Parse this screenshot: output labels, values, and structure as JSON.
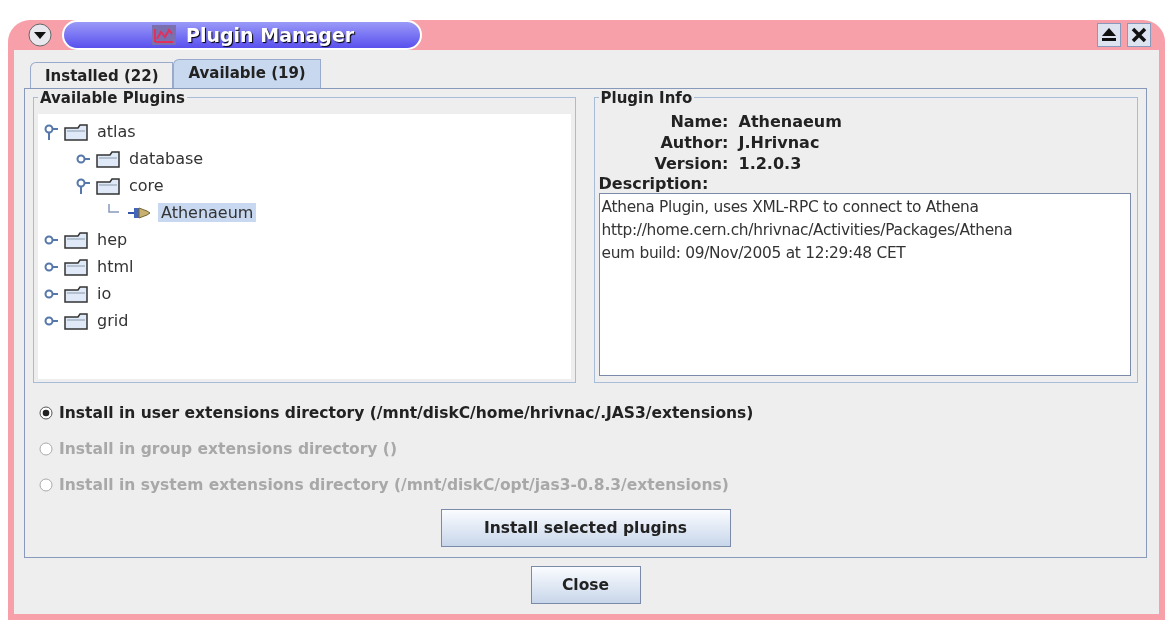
{
  "window": {
    "title": "Plugin Manager"
  },
  "tabs": [
    {
      "label": "Installed (22)",
      "selected": false
    },
    {
      "label": "Available (19)",
      "selected": true
    }
  ],
  "tree_panel": {
    "title": "Available Plugins",
    "items": [
      {
        "label": "atlas",
        "kind": "folder",
        "expanded": true,
        "selected": false,
        "children": [
          {
            "label": "database",
            "kind": "folder",
            "expanded": false,
            "selected": false
          },
          {
            "label": "core",
            "kind": "folder",
            "expanded": true,
            "selected": false,
            "children": [
              {
                "label": "Athenaeum",
                "kind": "plugin",
                "selected": true
              }
            ]
          }
        ]
      },
      {
        "label": "hep",
        "kind": "folder",
        "expanded": false,
        "selected": false
      },
      {
        "label": "html",
        "kind": "folder",
        "expanded": false,
        "selected": false
      },
      {
        "label": "io",
        "kind": "folder",
        "expanded": false,
        "selected": false
      },
      {
        "label": "grid",
        "kind": "folder",
        "expanded": false,
        "selected": false
      }
    ]
  },
  "info_panel": {
    "title": "Plugin Info",
    "fields": [
      {
        "label": "Name:",
        "value": "Athenaeum"
      },
      {
        "label": "Author:",
        "value": "J.Hrivnac"
      },
      {
        "label": "Version:",
        "value": "1.2.0.3"
      }
    ],
    "description_label": "Description:",
    "description_lines": [
      "Athena Plugin, uses XML-RPC to connect to Athena",
      "http://home.cern.ch/hrivnac/Activities/Packages/Athena",
      "eum build: 09/Nov/2005 at 12:29:48 CET"
    ]
  },
  "install_options": [
    {
      "label": "Install in user extensions directory (/mnt/diskC/home/hrivnac/.JAS3/extensions)",
      "selected": true,
      "disabled": false
    },
    {
      "label": "Install in group extensions directory ()",
      "selected": false,
      "disabled": true
    },
    {
      "label": "Install in system extensions directory (/mnt/diskC/opt/jas3-0.8.3/extensions)",
      "selected": false,
      "disabled": true
    }
  ],
  "install_button": "Install selected plugins",
  "close_button": "Close"
}
